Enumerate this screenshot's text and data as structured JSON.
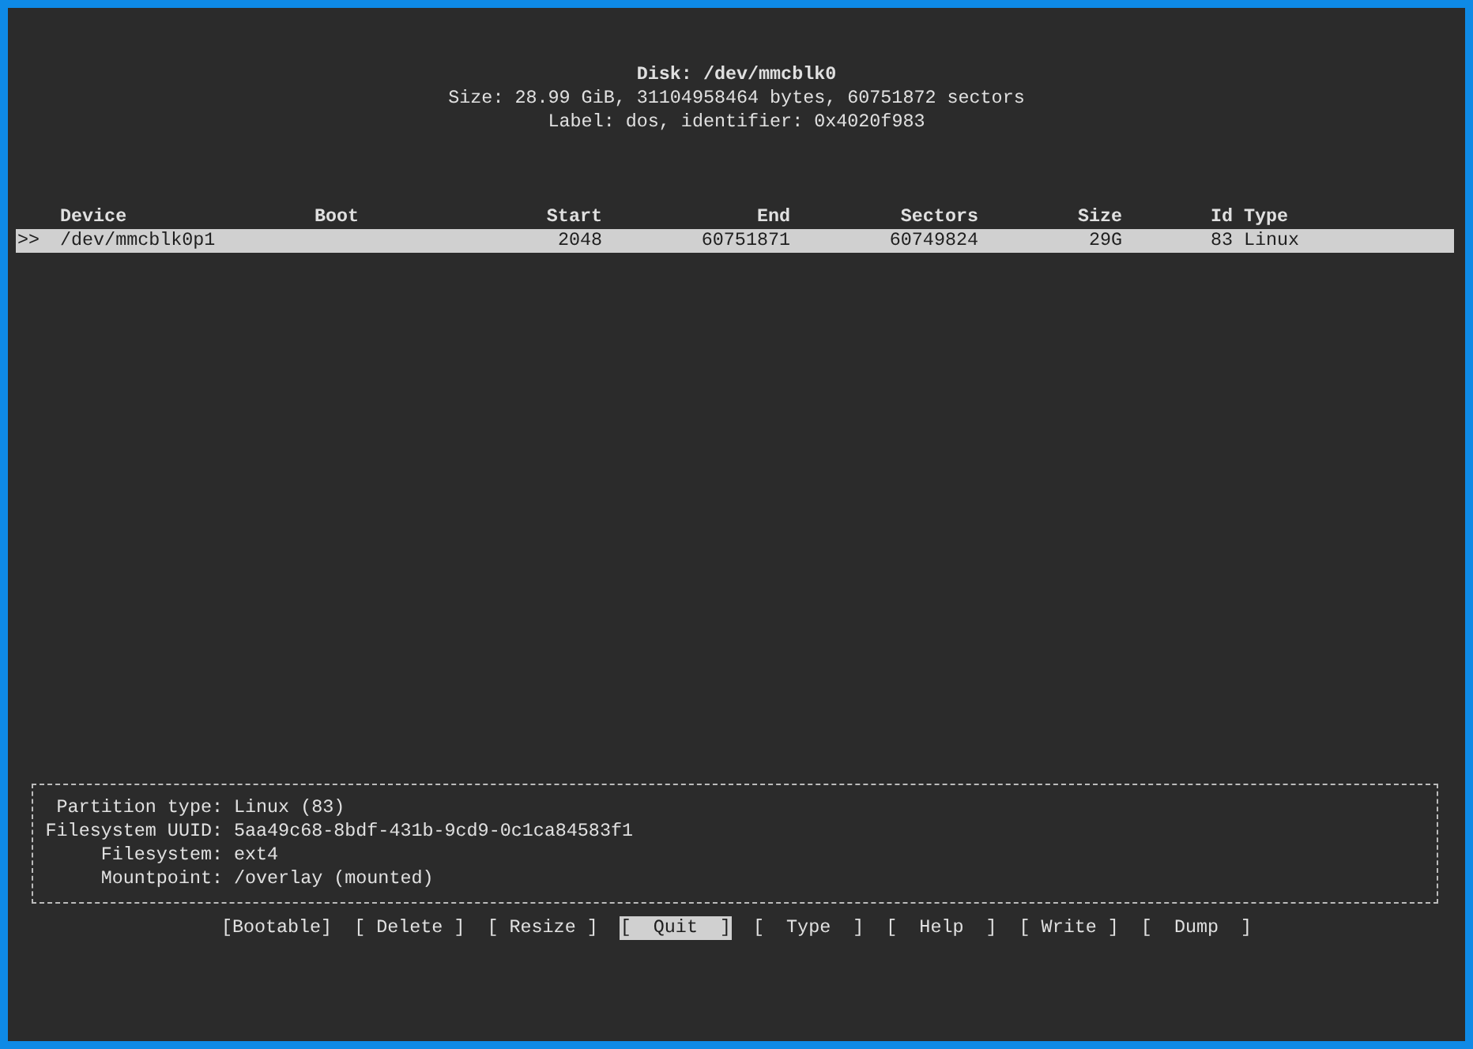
{
  "header": [
    "Disk: /dev/mmcblk0",
    "Size: 28.99 GiB, 31104958464 bytes, 60751872 sectors",
    "Label: dos, identifier: 0x4020f983"
  ],
  "table": {
    "columns": [
      "Device",
      "Boot",
      "Start",
      "End",
      "Sectors",
      "Size",
      "Id",
      "Type"
    ],
    "rows": [
      {
        "marker": ">>",
        "cells": [
          "/dev/mmcblk0p1",
          "",
          "2048",
          "60751871",
          "60749824",
          "29G",
          "83",
          "Linux"
        ],
        "selected": true
      }
    ]
  },
  "info": [
    {
      "label": "Partition type:",
      "value": "Linux (83)"
    },
    {
      "label": "Filesystem UUID:",
      "value": "5aa49c68-8bdf-431b-9cd9-0c1ca84583f1"
    },
    {
      "label": "Filesystem:",
      "value": "ext4"
    },
    {
      "label": "Mountpoint:",
      "value": "/overlay (mounted)"
    }
  ],
  "buttons": [
    {
      "label": "[Bootable]",
      "selected": false
    },
    {
      "label": "[ Delete ]",
      "selected": false
    },
    {
      "label": "[ Resize ]",
      "selected": false
    },
    {
      "label": "[  Quit  ]",
      "selected": true
    },
    {
      "label": "[  Type  ]",
      "selected": false
    },
    {
      "label": "[  Help  ]",
      "selected": false
    },
    {
      "label": "[ Write ]",
      "selected": false
    },
    {
      "label": "[  Dump  ]",
      "selected": false
    }
  ]
}
